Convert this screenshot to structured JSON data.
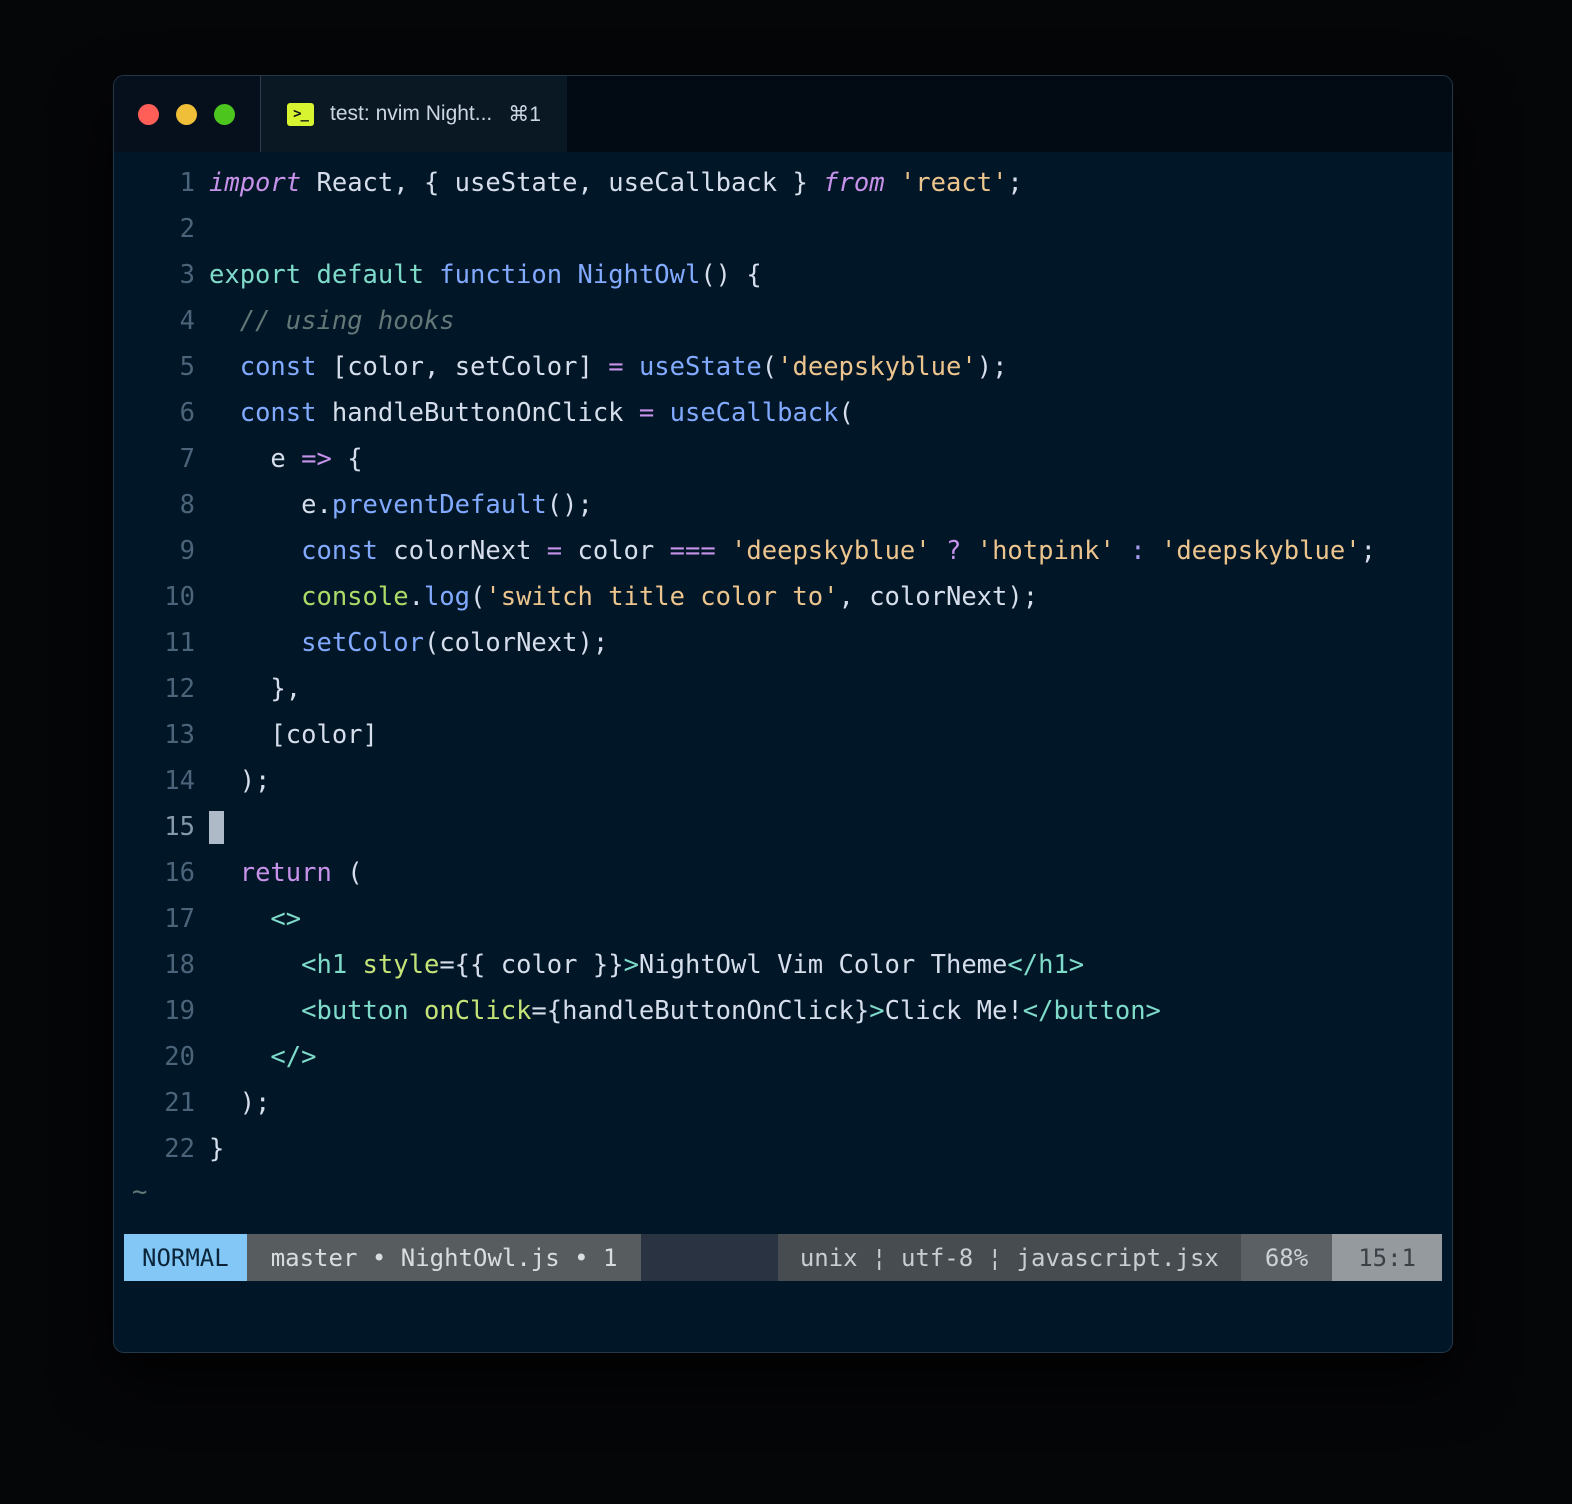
{
  "window": {
    "traffic_lights": [
      "close",
      "minimize",
      "maximize"
    ],
    "tab": {
      "icon": "terminal-icon",
      "icon_glyph": ">_",
      "title": "test: nvim Night...",
      "shortcut": "⌘1"
    }
  },
  "editor": {
    "tilde_marker": "~",
    "cursor_line": 15,
    "lines": [
      {
        "n": "1",
        "tokens": [
          {
            "t": "import",
            "c": "kw-import"
          },
          {
            "t": " ",
            "c": "plain"
          },
          {
            "t": "React",
            "c": "plain"
          },
          {
            "t": ", { ",
            "c": "punct"
          },
          {
            "t": "useState",
            "c": "plain"
          },
          {
            "t": ", ",
            "c": "punct"
          },
          {
            "t": "useCallback",
            "c": "plain"
          },
          {
            "t": " } ",
            "c": "punct"
          },
          {
            "t": "from",
            "c": "kw-from"
          },
          {
            "t": " ",
            "c": "plain"
          },
          {
            "t": "'react'",
            "c": "str"
          },
          {
            "t": ";",
            "c": "punct"
          }
        ]
      },
      {
        "n": "2",
        "tokens": []
      },
      {
        "n": "3",
        "tokens": [
          {
            "t": "export default",
            "c": "kw-export"
          },
          {
            "t": " ",
            "c": "plain"
          },
          {
            "t": "function",
            "c": "kw-function"
          },
          {
            "t": " ",
            "c": "plain"
          },
          {
            "t": "NightOwl",
            "c": "fnname"
          },
          {
            "t": "() {",
            "c": "punct"
          }
        ]
      },
      {
        "n": "4",
        "tokens": [
          {
            "t": "  ",
            "c": "plain"
          },
          {
            "t": "// using hooks",
            "c": "comment"
          }
        ]
      },
      {
        "n": "5",
        "tokens": [
          {
            "t": "  ",
            "c": "plain"
          },
          {
            "t": "const",
            "c": "kw-const"
          },
          {
            "t": " [",
            "c": "punct"
          },
          {
            "t": "color",
            "c": "plain"
          },
          {
            "t": ", ",
            "c": "punct"
          },
          {
            "t": "setColor",
            "c": "plain"
          },
          {
            "t": "] ",
            "c": "punct"
          },
          {
            "t": "=",
            "c": "op"
          },
          {
            "t": " ",
            "c": "plain"
          },
          {
            "t": "useState",
            "c": "method"
          },
          {
            "t": "(",
            "c": "punct"
          },
          {
            "t": "'deepskyblue'",
            "c": "str"
          },
          {
            "t": ");",
            "c": "punct"
          }
        ]
      },
      {
        "n": "6",
        "tokens": [
          {
            "t": "  ",
            "c": "plain"
          },
          {
            "t": "const",
            "c": "kw-const"
          },
          {
            "t": " ",
            "c": "plain"
          },
          {
            "t": "handleButtonOnClick",
            "c": "plain"
          },
          {
            "t": " ",
            "c": "plain"
          },
          {
            "t": "=",
            "c": "op"
          },
          {
            "t": " ",
            "c": "plain"
          },
          {
            "t": "useCallback",
            "c": "method"
          },
          {
            "t": "(",
            "c": "punct"
          }
        ]
      },
      {
        "n": "7",
        "tokens": [
          {
            "t": "    ",
            "c": "plain"
          },
          {
            "t": "e",
            "c": "plain"
          },
          {
            "t": " ",
            "c": "plain"
          },
          {
            "t": "=>",
            "c": "op"
          },
          {
            "t": " {",
            "c": "punct"
          }
        ]
      },
      {
        "n": "8",
        "tokens": [
          {
            "t": "      ",
            "c": "plain"
          },
          {
            "t": "e",
            "c": "plain"
          },
          {
            "t": ".",
            "c": "punct"
          },
          {
            "t": "preventDefault",
            "c": "method"
          },
          {
            "t": "();",
            "c": "punct"
          }
        ]
      },
      {
        "n": "9",
        "tokens": [
          {
            "t": "      ",
            "c": "plain"
          },
          {
            "t": "const",
            "c": "kw-const"
          },
          {
            "t": " ",
            "c": "plain"
          },
          {
            "t": "colorNext",
            "c": "plain"
          },
          {
            "t": " ",
            "c": "plain"
          },
          {
            "t": "=",
            "c": "op"
          },
          {
            "t": " ",
            "c": "plain"
          },
          {
            "t": "color",
            "c": "plain"
          },
          {
            "t": " ",
            "c": "plain"
          },
          {
            "t": "===",
            "c": "op"
          },
          {
            "t": " ",
            "c": "plain"
          },
          {
            "t": "'deepskyblue'",
            "c": "str"
          },
          {
            "t": " ",
            "c": "plain"
          },
          {
            "t": "?",
            "c": "opq"
          },
          {
            "t": " ",
            "c": "plain"
          },
          {
            "t": "'hotpink'",
            "c": "str"
          },
          {
            "t": " ",
            "c": "plain"
          },
          {
            "t": ":",
            "c": "opc"
          },
          {
            "t": " ",
            "c": "plain"
          },
          {
            "t": "'deepskyblue'",
            "c": "str"
          },
          {
            "t": ";",
            "c": "punct"
          }
        ]
      },
      {
        "n": "10",
        "tokens": [
          {
            "t": "      ",
            "c": "plain"
          },
          {
            "t": "console",
            "c": "obj"
          },
          {
            "t": ".",
            "c": "punct"
          },
          {
            "t": "log",
            "c": "method"
          },
          {
            "t": "(",
            "c": "punct"
          },
          {
            "t": "'switch title color to'",
            "c": "str"
          },
          {
            "t": ", ",
            "c": "punct"
          },
          {
            "t": "colorNext",
            "c": "plain"
          },
          {
            "t": ");",
            "c": "punct"
          }
        ]
      },
      {
        "n": "11",
        "tokens": [
          {
            "t": "      ",
            "c": "plain"
          },
          {
            "t": "setColor",
            "c": "method"
          },
          {
            "t": "(",
            "c": "punct"
          },
          {
            "t": "colorNext",
            "c": "plain"
          },
          {
            "t": ");",
            "c": "punct"
          }
        ]
      },
      {
        "n": "12",
        "tokens": [
          {
            "t": "    },",
            "c": "punct"
          }
        ]
      },
      {
        "n": "13",
        "tokens": [
          {
            "t": "    [",
            "c": "punct"
          },
          {
            "t": "color",
            "c": "plain"
          },
          {
            "t": "]",
            "c": "punct"
          }
        ]
      },
      {
        "n": "14",
        "tokens": [
          {
            "t": "  );",
            "c": "punct"
          }
        ]
      },
      {
        "n": "15",
        "tokens": [],
        "cursor": true
      },
      {
        "n": "16",
        "tokens": [
          {
            "t": "  ",
            "c": "plain"
          },
          {
            "t": "return",
            "c": "kw-return"
          },
          {
            "t": " (",
            "c": "punct"
          }
        ]
      },
      {
        "n": "17",
        "tokens": [
          {
            "t": "    ",
            "c": "plain"
          },
          {
            "t": "<>",
            "c": "tag"
          }
        ]
      },
      {
        "n": "18",
        "tokens": [
          {
            "t": "      ",
            "c": "plain"
          },
          {
            "t": "<h1",
            "c": "tag"
          },
          {
            "t": " ",
            "c": "plain"
          },
          {
            "t": "style",
            "c": "attr"
          },
          {
            "t": "=",
            "c": "punct"
          },
          {
            "t": "{{ ",
            "c": "punct"
          },
          {
            "t": "color",
            "c": "plain"
          },
          {
            "t": " }}",
            "c": "punct"
          },
          {
            "t": ">",
            "c": "tag"
          },
          {
            "t": "NightOwl Vim Color Theme",
            "c": "jsxtext"
          },
          {
            "t": "</h1>",
            "c": "tag"
          }
        ]
      },
      {
        "n": "19",
        "tokens": [
          {
            "t": "      ",
            "c": "plain"
          },
          {
            "t": "<button",
            "c": "tag"
          },
          {
            "t": " ",
            "c": "plain"
          },
          {
            "t": "onClick",
            "c": "attr"
          },
          {
            "t": "=",
            "c": "punct"
          },
          {
            "t": "{",
            "c": "punct"
          },
          {
            "t": "handleButtonOnClick",
            "c": "plain"
          },
          {
            "t": "}",
            "c": "punct"
          },
          {
            "t": ">",
            "c": "tag"
          },
          {
            "t": "Click Me!",
            "c": "jsxtext"
          },
          {
            "t": "</button>",
            "c": "tag"
          }
        ]
      },
      {
        "n": "20",
        "tokens": [
          {
            "t": "    ",
            "c": "plain"
          },
          {
            "t": "</>",
            "c": "tag"
          }
        ]
      },
      {
        "n": "21",
        "tokens": [
          {
            "t": "  );",
            "c": "punct"
          }
        ]
      },
      {
        "n": "22",
        "tokens": [
          {
            "t": "}",
            "c": "punct"
          }
        ]
      }
    ]
  },
  "statusline": {
    "mode": "NORMAL",
    "branch_file": "master • NightOwl.js • 1",
    "fileinfo": "unix ¦ utf-8 ¦ javascript.jsx",
    "percent": "68%",
    "position": "15:1"
  },
  "colors": {
    "background": "#011627",
    "mode_badge": "#82c7f5",
    "string": "#ecc48d",
    "keyword": "#c792ea",
    "function": "#82aaff",
    "tag": "#7fdbca",
    "attribute": "#c5e478",
    "comment": "#637777",
    "foreground": "#d6deeb"
  }
}
